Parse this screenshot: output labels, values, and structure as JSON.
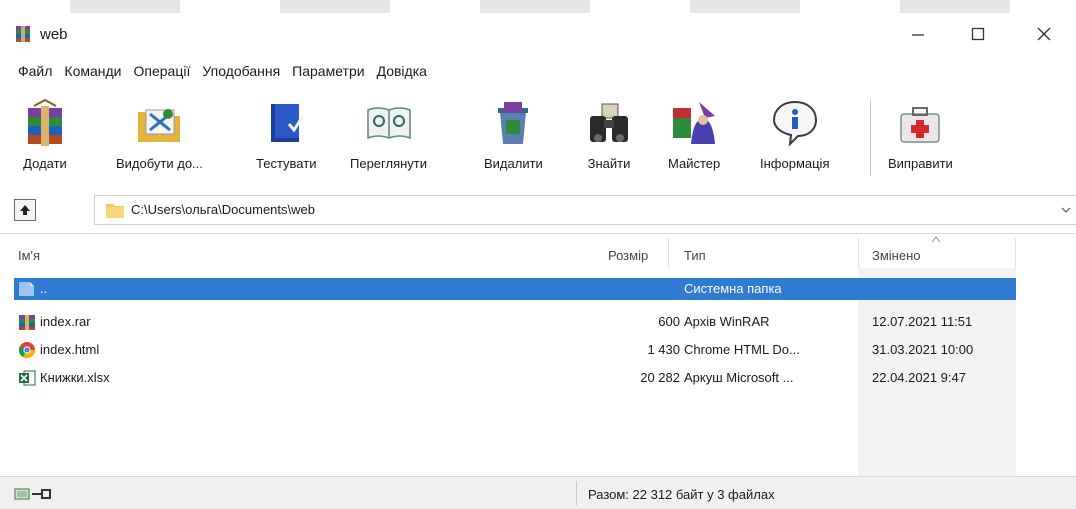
{
  "window": {
    "title": "web",
    "minimize_glyph": "—",
    "maximize_glyph": "☐",
    "close_glyph": "✕"
  },
  "menu": [
    "Файл",
    "Команди",
    "Операції",
    "Уподобання",
    "Параметри",
    "Довідка"
  ],
  "toolbar": {
    "add": "Додати",
    "extract": "Видобути до...",
    "test": "Тестувати",
    "view": "Переглянути",
    "delete": "Видалити",
    "find": "Знайти",
    "wizard": "Майстер",
    "info": "Інформація",
    "repair": "Виправити"
  },
  "address": {
    "path": "C:\\Users\\ольга\\Documents\\web"
  },
  "columns": {
    "name": "Ім'я",
    "size": "Розмір",
    "type": "Тип",
    "modified": "Змінено"
  },
  "files": [
    {
      "name": "..",
      "size": "",
      "type": "Системна папка",
      "modified": "",
      "icon": "folder-icon",
      "selected": true
    },
    {
      "name": "index.rar",
      "size": "600",
      "type": "Архів WinRAR",
      "modified": "12.07.2021 11:51",
      "icon": "winrar-archive-icon"
    },
    {
      "name": "index.html",
      "size": "1 430",
      "type": "Chrome HTML Do...",
      "modified": "31.03.2021 10:00",
      "icon": "chrome-icon"
    },
    {
      "name": "Книжки.xlsx",
      "size": "20 282",
      "type": "Аркуш Microsoft ...",
      "modified": "22.04.2021 9:47",
      "icon": "excel-icon"
    }
  ],
  "status": {
    "summary": "Разом: 22 312 байт у 3 файлах"
  },
  "colors": {
    "selection": "#2f7bd1"
  }
}
